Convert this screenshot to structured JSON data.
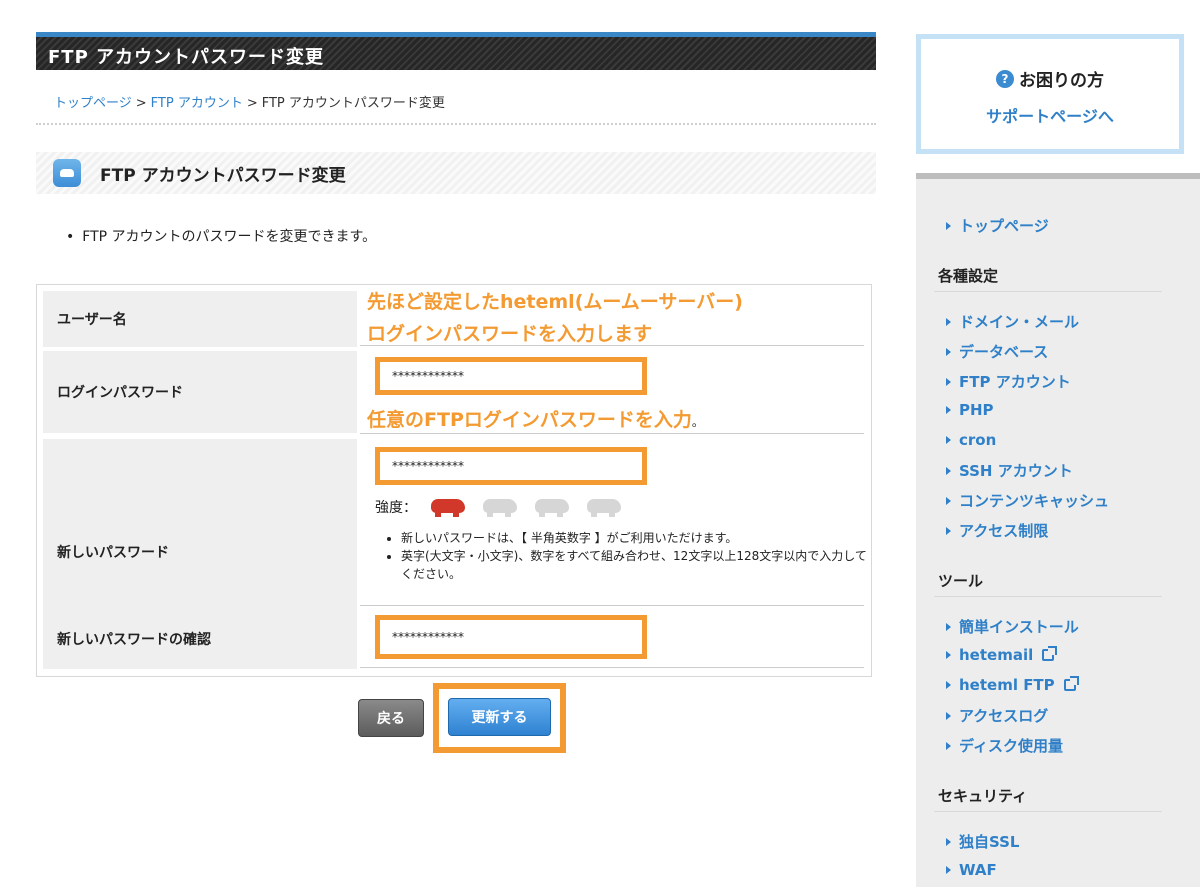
{
  "page": {
    "title": "FTP アカウントパスワード変更",
    "breadcrumb": {
      "home": "トップページ",
      "parent": "FTP アカウント",
      "current": "FTP アカウントパスワード変更",
      "sep": ">"
    },
    "section_title": "FTP アカウントパスワード変更",
    "description": "FTP アカウントのパスワードを変更できます。"
  },
  "form": {
    "user_label": "ユーザー名",
    "login_pw_label": "ログインパスワード",
    "new_pw_label": "新しいパスワード",
    "confirm_label": "新しいパスワードの確認",
    "login_pw_value": "************",
    "new_pw_value": "************",
    "confirm_value": "************",
    "strength_label": "強度：",
    "strength_level": 1,
    "strength_max": 4,
    "note1": "新しいパスワードは、【 半角英数字 】がご利用いただけます。",
    "note2": "英字(大文字・小文字)、数字をすべて組み合わせ、12文字以上128文字以内で入力してください。"
  },
  "annotations": {
    "line1": "先ほど設定したheteml(ムームーサーバー)",
    "line2": "ログインパスワードを入力します",
    "line3": "任意のFTPログインパスワードを入力",
    "dot": "。"
  },
  "buttons": {
    "back": "戻る",
    "update": "更新する"
  },
  "help": {
    "title": "お困りの方",
    "link": "サポートページへ",
    "icon": "?"
  },
  "sidebar": {
    "top": "トップページ",
    "settings_head": "各種設定",
    "settings": [
      "ドメイン・メール",
      "データベース",
      "FTP アカウント",
      "PHP",
      "cron",
      "SSH アカウント",
      "コンテンツキャッシュ",
      "アクセス制限"
    ],
    "tools_head": "ツール",
    "tools": [
      "簡単インストール",
      "hetemail",
      "heteml FTP",
      "アクセスログ",
      "ディスク使用量"
    ],
    "security_head": "セキュリティ",
    "security": [
      "独自SSL",
      "WAF"
    ]
  },
  "colors": {
    "accent": "#f39b32",
    "link": "#2f80c8",
    "strength_on": "#d2382a",
    "strength_off": "#d6d6d6"
  }
}
